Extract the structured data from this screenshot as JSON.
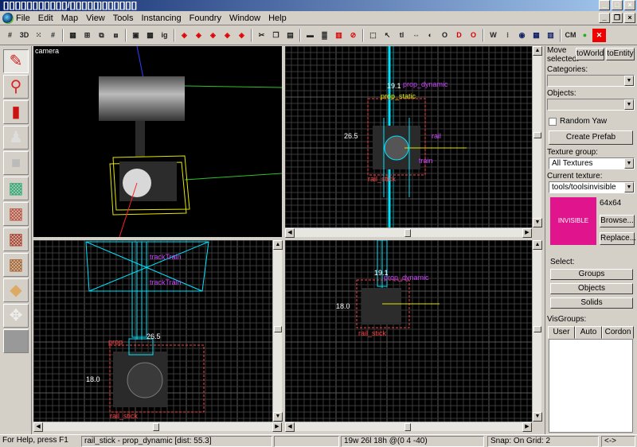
{
  "titlebar": {
    "title": "[][][][][][][][][][][]/[][][][][]][][][][][][]"
  },
  "menu": [
    "File",
    "Edit",
    "Map",
    "View",
    "Tools",
    "Instancing",
    "Foundry",
    "Window",
    "Help"
  ],
  "toolbar_icons": [
    "grid-icon",
    "3d-grid-icon",
    "dots-grid-icon",
    "hash-grid-icon",
    "toggle-grid-icon",
    "carve-icon",
    "group-icon",
    "ungroup-icon",
    "hide-icon",
    "texture-lock-icon",
    "ig-icon",
    "cube-red-icon",
    "cube-red-2-icon",
    "cube-red-3-icon",
    "cube-red-4-icon",
    "cube-red-5-icon",
    "cut-icon",
    "copy-icon",
    "paste-icon",
    "run-map-icon",
    "toggle-models-icon",
    "toggle-red-icon",
    "no-entry-icon",
    "box-select-icon",
    "cursor-icon",
    "tl-icon",
    "arrows-icon",
    "clip-icon",
    "ob-icon",
    "dw-icon",
    "ow-icon",
    "cw-icon",
    "dots-icon",
    "sphere-icon",
    "grid-cube-icon",
    "bars-icon",
    "cm-icon",
    "leaf-icon",
    "no-draw-icon"
  ],
  "toolbar": {
    "ig": "ig",
    "tl": "tl",
    "cm": "CM",
    "nodraw": "no draw"
  },
  "tools": [
    "selection-tool-icon",
    "magnify-tool-icon",
    "camera-tool-icon",
    "entity-tool-icon",
    "block-tool-icon",
    "texture-application-icon",
    "apply-texture-icon",
    "decal-tool-icon",
    "overlay-tool-icon",
    "clipping-tool-icon",
    "vertex-tool-icon",
    "path-tool-icon"
  ],
  "viewports": {
    "camera": {
      "label": "camera"
    },
    "top": {
      "labels": {
        "name": "prop_dynamic",
        "dim_w": "19.1",
        "dim_h": "26.5",
        "prop_static": "prop_static",
        "rail": "rail",
        "train": "train",
        "rail_stick": "rail_stick"
      }
    },
    "front": {
      "labels": {
        "a": "trackTrain",
        "b": "trackTrain",
        "dim_w": "26.5",
        "dim_h": "18.0",
        "prop": "prop",
        "rail_stick": "rail_stick"
      }
    },
    "side": {
      "labels": {
        "name": "prop_dynamic",
        "dim_w": "19.1",
        "dim_h": "18.0",
        "rail_stick": "rail_stick"
      }
    }
  },
  "panel": {
    "move_selected": "Move selected:",
    "to_world": "toWorld",
    "to_entity": "toEntity",
    "categories_label": "Categories:",
    "objects_label": "Objects:",
    "random_yaw": "Random Yaw",
    "create_prefab": "Create Prefab",
    "texture_group_label": "Texture group:",
    "texture_group_value": "All Textures",
    "current_texture_label": "Current texture:",
    "current_texture_value": "tools/toolsinvisible",
    "texture_size": "64x64",
    "texture_name": "INVISIBLE",
    "browse": "Browse...",
    "replace": "Replace...",
    "select_label": "Select:",
    "groups": "Groups",
    "objects": "Objects",
    "solids": "Solids",
    "visgroups_label": "VisGroups:",
    "tabs": [
      "User",
      "Auto",
      "Cordon"
    ]
  },
  "colors": {
    "texture_swatch": "#e0148c",
    "selection": "#ff0000",
    "cyan": "#00e5ff",
    "purple": "#cc44ff",
    "grid": "#3a3a3a"
  },
  "status": {
    "help": "For Help, press F1",
    "selection": "rail_stick - prop_dynamic  [dist: 55.3]",
    "size": "19w 26l 18h @(0 4 -40)",
    "snap": "Snap: On Grid: 2",
    "extra": "<->"
  }
}
